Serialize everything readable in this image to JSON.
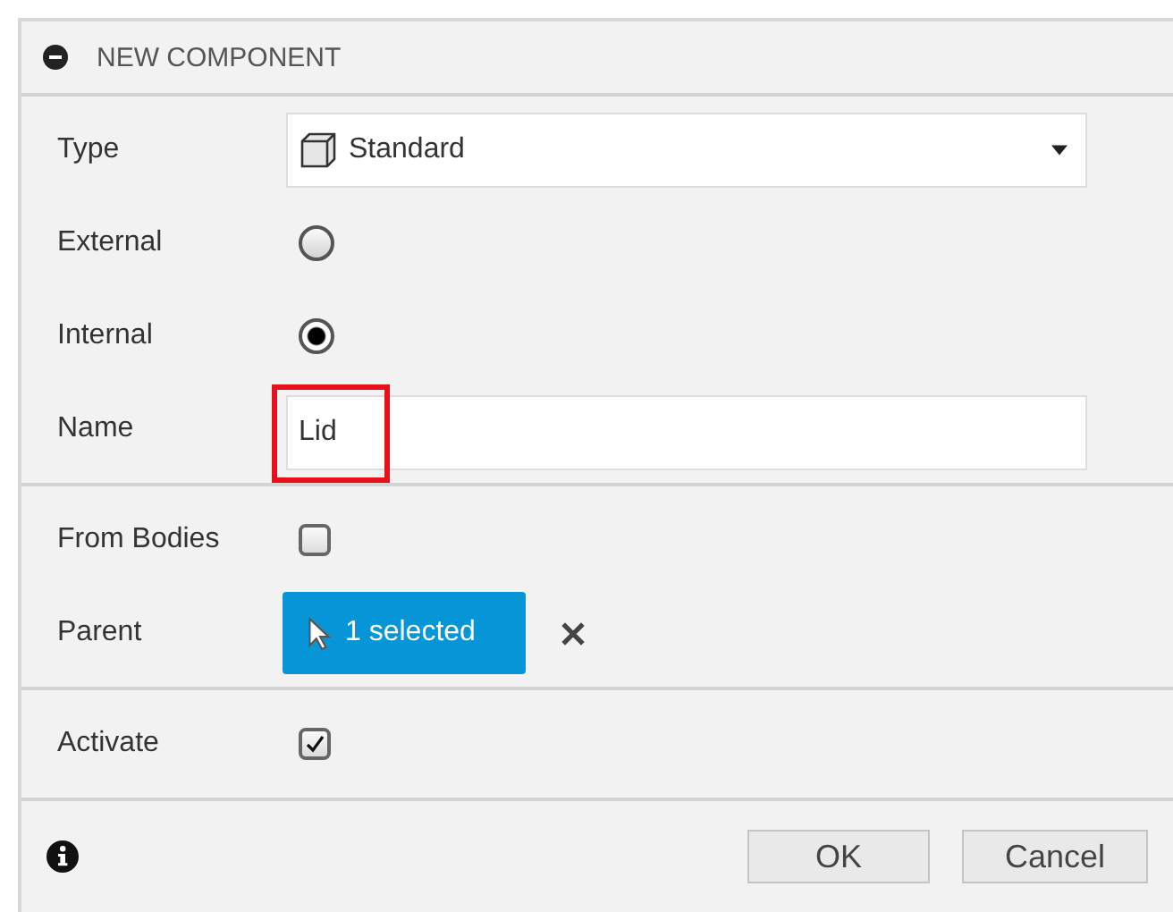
{
  "panel": {
    "title": "NEW COMPONENT"
  },
  "sections": [
    {
      "rows": [
        {
          "kind": "dropdown",
          "label": "Type",
          "value": "Standard"
        },
        {
          "kind": "radio",
          "label": "External",
          "selected": false
        },
        {
          "kind": "radio",
          "label": "Internal",
          "selected": true
        },
        {
          "kind": "text",
          "label": "Name",
          "value": "Lid",
          "highlighted": true
        }
      ]
    },
    {
      "rows": [
        {
          "kind": "checkbox",
          "label": "From Bodies",
          "checked": false
        },
        {
          "kind": "selection",
          "label": "Parent",
          "value": "1 selected"
        }
      ]
    },
    {
      "rows": [
        {
          "kind": "checkbox",
          "label": "Activate",
          "checked": true
        }
      ]
    }
  ],
  "buttons": [
    "OK",
    "Cancel"
  ]
}
